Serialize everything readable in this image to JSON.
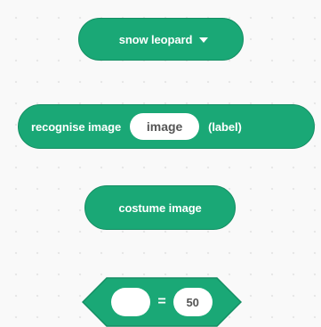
{
  "colors": {
    "block_fill": "#1aa876",
    "block_border": "#148e63",
    "canvas_bg": "#f9f9f9",
    "input_bg": "#ffffff",
    "input_text": "#555555"
  },
  "blocks": {
    "dropdown_reporter": {
      "label": "snow leopard",
      "icon": "dropdown-arrow-icon"
    },
    "recognise_block": {
      "label": "recognise image",
      "input_value": "image",
      "suffix": "(label)"
    },
    "costume_block": {
      "label": "costume image"
    },
    "equals_block": {
      "left_value": "",
      "operator": "=",
      "right_value": "50"
    }
  }
}
